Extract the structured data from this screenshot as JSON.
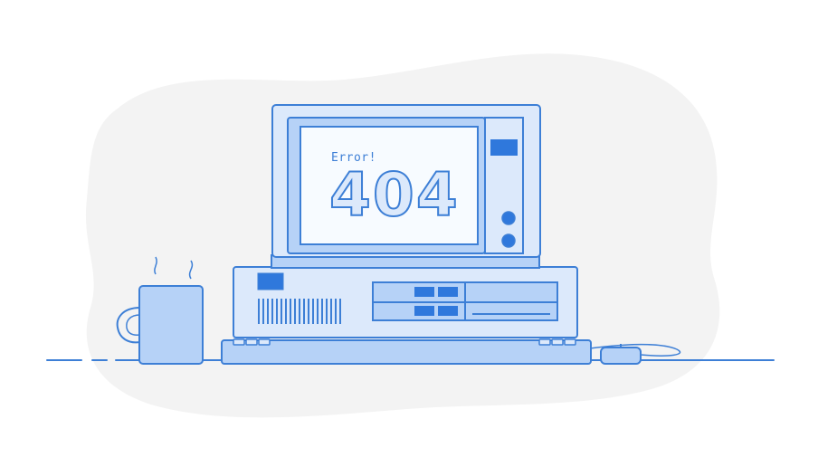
{
  "illustration": {
    "error_label": "Error!",
    "error_code": "404"
  },
  "colors": {
    "background_blob": "#f3f3f3",
    "outline": "#3d7fd6",
    "fill_light": "#dce9fb",
    "fill_mid": "#b6d2f7",
    "fill_dark": "#2f78dc",
    "screen": "#f7fbff"
  },
  "icons": {
    "computer": "retro-computer-icon",
    "mug": "coffee-mug-icon",
    "mouse": "mouse-icon",
    "keyboard": "keyboard-icon"
  }
}
